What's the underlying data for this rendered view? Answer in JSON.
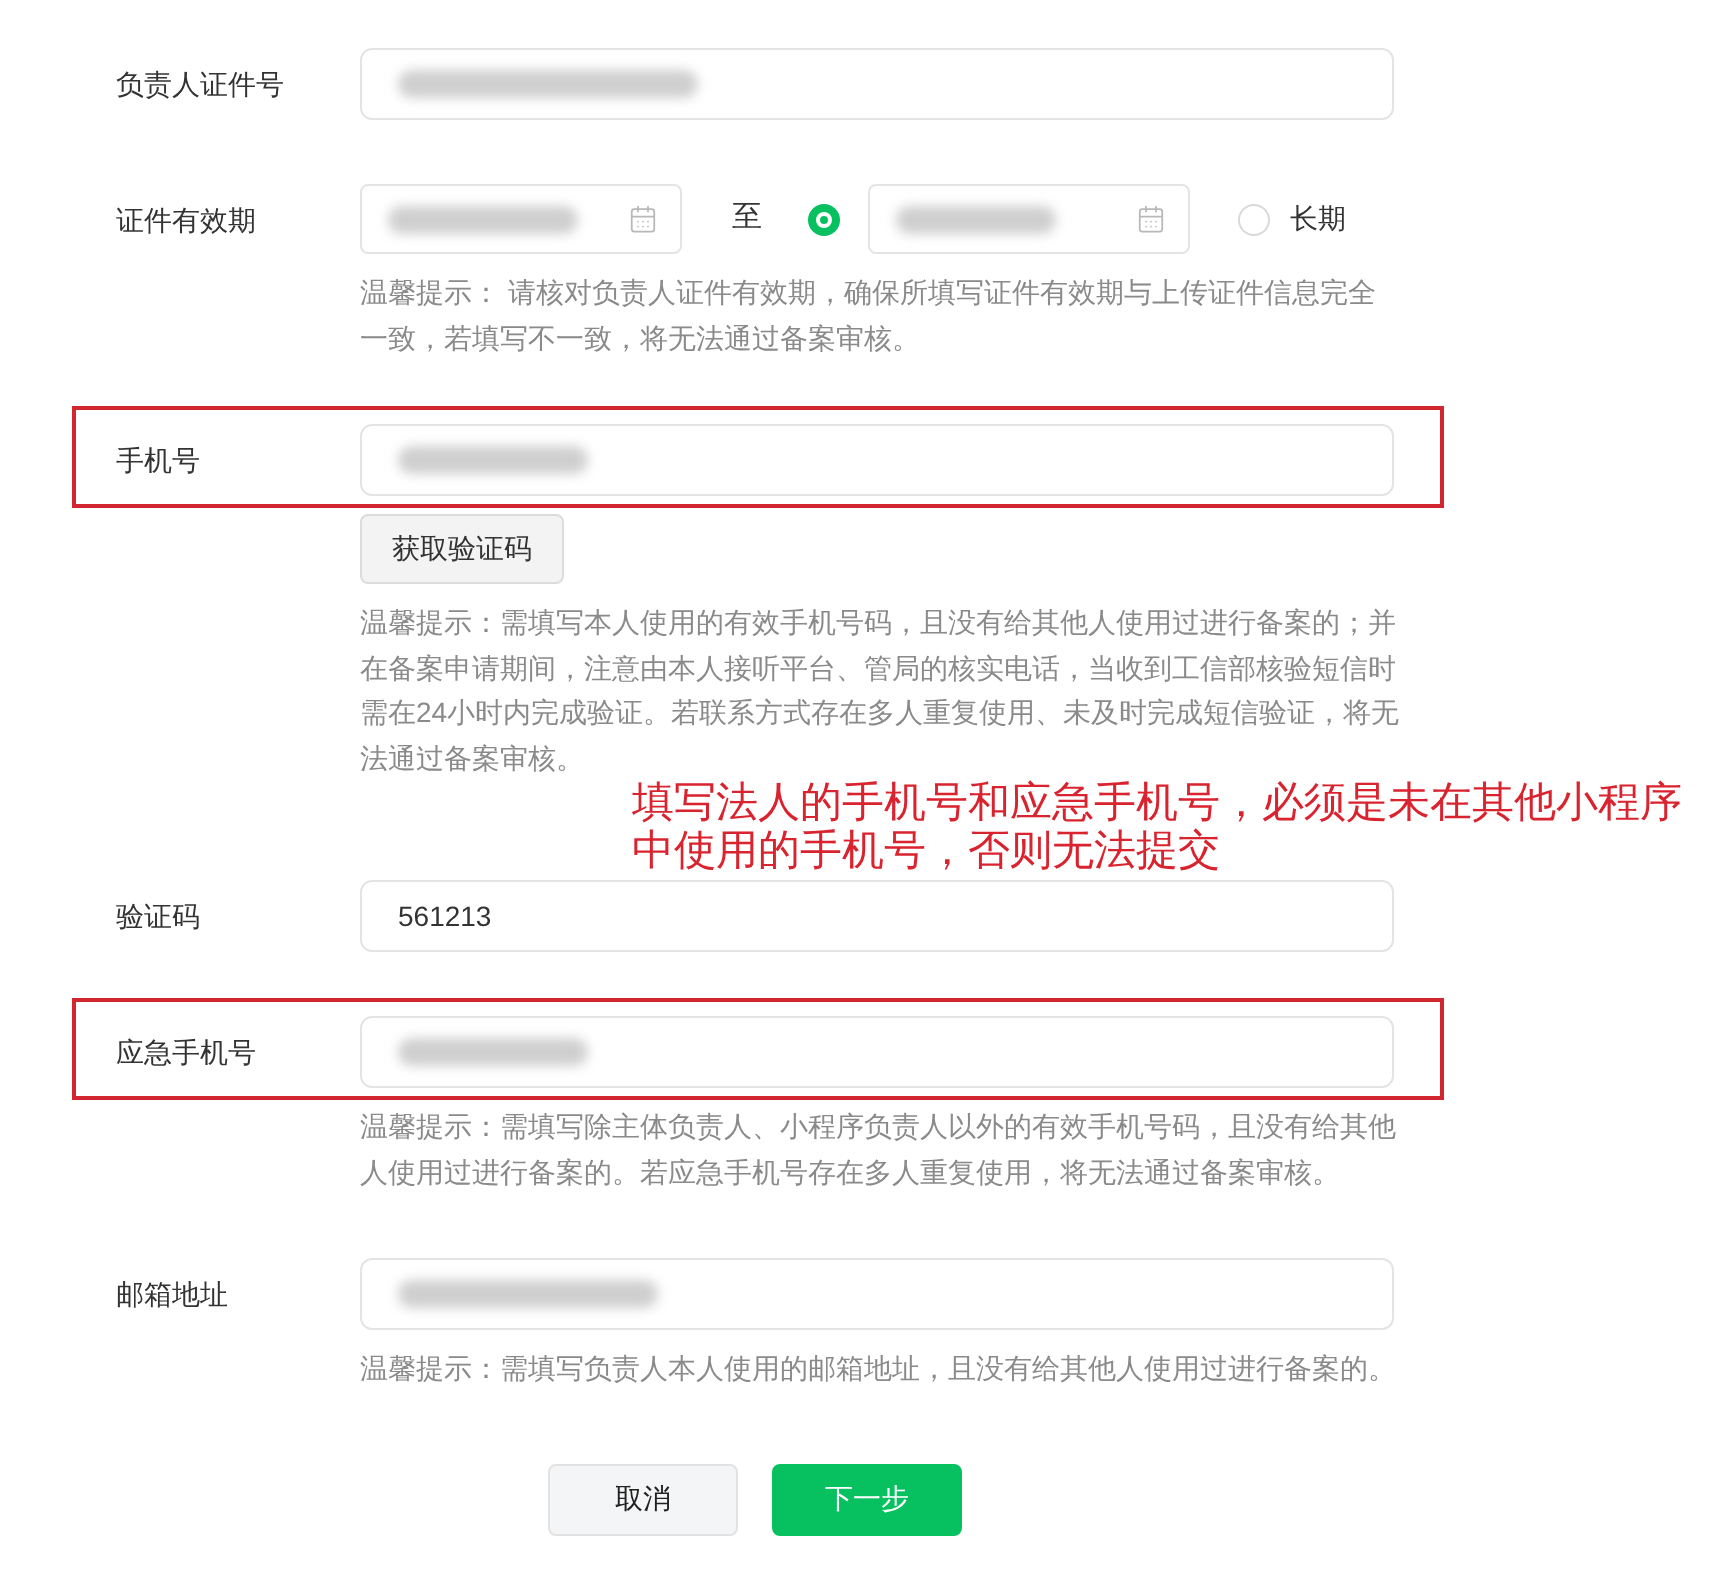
{
  "form": {
    "rows": [
      {
        "kind": "input",
        "label": "负责人证件号",
        "redacted": true,
        "highlighted": false
      },
      {
        "kind": "date_range",
        "label": "证件有效期",
        "start": {
          "redacted": true
        },
        "separator": "至",
        "end_date": {
          "selected": true,
          "redacted": true
        },
        "long_term": {
          "label": "长期",
          "selected": false
        },
        "hint": "温馨提示： 请核对负责人证件有效期，确保所填写证件有效期与上传证件信息完全一致，若填写不一致，将无法通过备案审核。"
      },
      {
        "kind": "input",
        "label": "手机号",
        "redacted": true,
        "highlighted": true,
        "action_button": "获取验证码",
        "hint": "温馨提示：需填写本人使用的有效手机号码，且没有给其他人使用过进行备案的；并在备案申请期间，注意由本人接听平台、管局的核实电话，当收到工信部核验短信时需在24小时内完成验证。若联系方式存在多人重复使用、未及时完成短信验证，将无法通过备案审核。",
        "annotation": "填写法人的手机号和应急手机号，必须是未在其他小程序中使用的手机号，否则无法提交"
      },
      {
        "kind": "input",
        "label": "验证码",
        "value": "561213",
        "redacted": false,
        "highlighted": false
      },
      {
        "kind": "input",
        "label": "应急手机号",
        "redacted": true,
        "highlighted": true,
        "hint": "温馨提示：需填写除主体负责人、小程序负责人以外的有效手机号码，且没有给其他人使用过进行备案的。若应急手机号存在多人重复使用，将无法通过备案审核。"
      },
      {
        "kind": "input",
        "label": "邮箱地址",
        "redacted": true,
        "highlighted": false,
        "hint": "温馨提示：需填写负责人本人使用的邮箱地址，且没有给其他人使用过进行备案的。"
      }
    ]
  },
  "buttons": [
    {
      "label": "取消",
      "kind": "secondary"
    },
    {
      "label": "下一步",
      "kind": "primary"
    }
  ]
}
